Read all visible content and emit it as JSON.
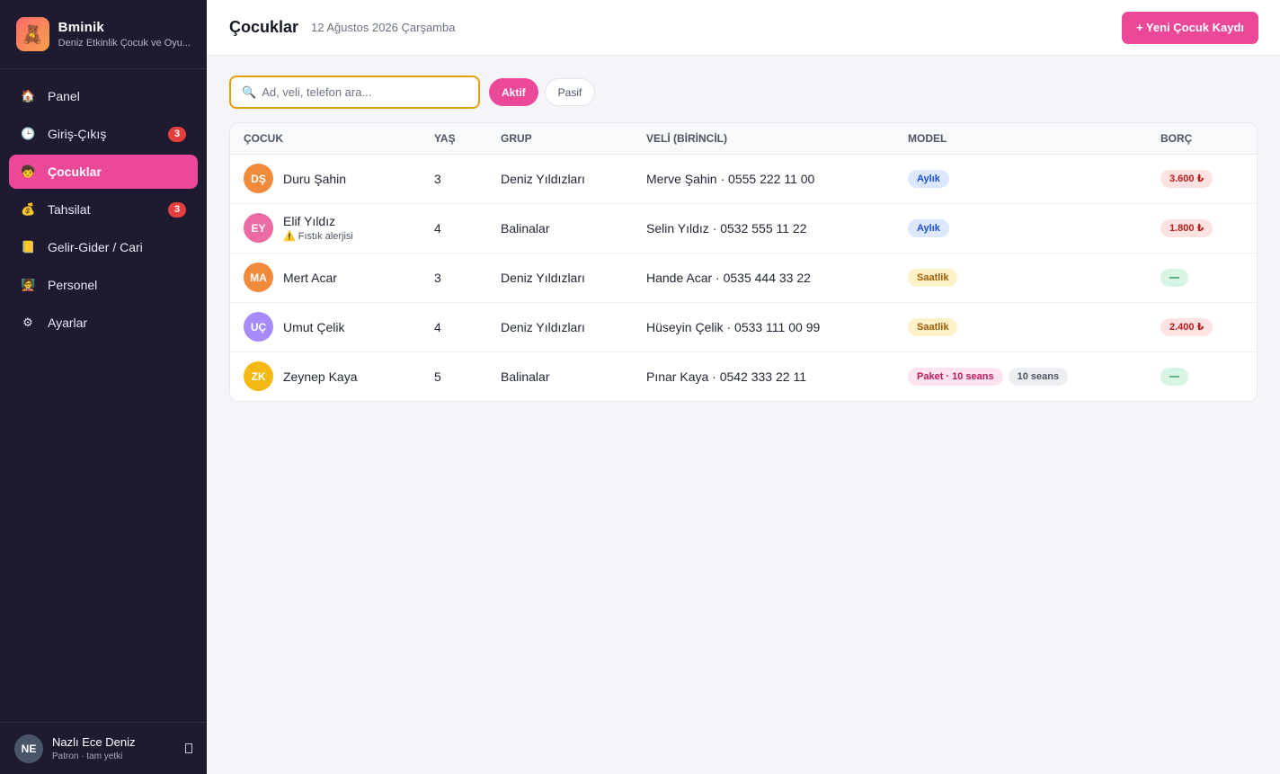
{
  "brand": {
    "icon": "teddy-bear-icon",
    "name": "Bminik",
    "subtitle": "Deniz Etkinlik Çocuk ve Oyu..."
  },
  "nav": [
    {
      "icon": "house-icon",
      "glyph": "🏠",
      "label": "Panel",
      "badge": ""
    },
    {
      "icon": "clock-icon",
      "glyph": "🕒",
      "label": "Giriş-Çıkış",
      "badge": "3"
    },
    {
      "icon": "child-icon",
      "glyph": "🧒",
      "label": "Çocuklar",
      "badge": "",
      "active": true
    },
    {
      "icon": "money-bag-icon",
      "glyph": "💰",
      "label": "Tahsilat",
      "badge": "3"
    },
    {
      "icon": "ledger-icon",
      "glyph": "📒",
      "label": "Gelir-Gider / Cari",
      "badge": ""
    },
    {
      "icon": "staff-icon",
      "glyph": "🧑‍🏫",
      "label": "Personel",
      "badge": ""
    },
    {
      "icon": "gear-icon",
      "glyph": "⚙",
      "label": "Ayarlar",
      "badge": ""
    }
  ],
  "user": {
    "initials": "NE",
    "name": "Nazlı Ece Deniz",
    "role": "Patron · tam yetki"
  },
  "header": {
    "title": "Çocuklar",
    "date": "12 Ağustos 2026 Çarşamba",
    "new_button": "+ Yeni Çocuk Kaydı"
  },
  "filters": {
    "search_placeholder": "Ad, veli, telefon ara...",
    "search_value": "",
    "active_label": "Aktif",
    "passive_label": "Pasif"
  },
  "table": {
    "headers": [
      "ÇOCUK",
      "YAŞ",
      "GRUP",
      "VELİ (BİRİNCİL)",
      "MODEL",
      "BORÇ"
    ],
    "rows": [
      {
        "initials": "DŞ",
        "color": "#f28a3c",
        "name": "Duru Şahin",
        "note": "",
        "age": "3",
        "group": "Deniz Yıldızları",
        "parent": "Merve Şahin · 0555 222 11 00",
        "model": "Aylık",
        "model_type": "aylik",
        "sessions": "",
        "debt": "3.600 ₺",
        "debt_type": "owe"
      },
      {
        "initials": "EY",
        "color": "#ec6ba5",
        "name": "Elif Yıldız",
        "note": "⚠️ Fıstık alerjisi",
        "age": "4",
        "group": "Balinalar",
        "parent": "Selin Yıldız · 0532 555 11 22",
        "model": "Aylık",
        "model_type": "aylik",
        "sessions": "",
        "debt": "1.800 ₺",
        "debt_type": "owe"
      },
      {
        "initials": "MA",
        "color": "#f28a3c",
        "name": "Mert Acar",
        "note": "",
        "age": "3",
        "group": "Deniz Yıldızları",
        "parent": "Hande Acar · 0535 444 33 22",
        "model": "Saatlik",
        "model_type": "saatlik",
        "sessions": "",
        "debt": "—",
        "debt_type": "none"
      },
      {
        "initials": "UÇ",
        "color": "#a78bfa",
        "name": "Umut Çelik",
        "note": "",
        "age": "4",
        "group": "Deniz Yıldızları",
        "parent": "Hüseyin Çelik · 0533 111 00 99",
        "model": "Saatlik",
        "model_type": "saatlik",
        "sessions": "",
        "debt": "2.400 ₺",
        "debt_type": "owe"
      },
      {
        "initials": "ZK",
        "color": "#f5b915",
        "name": "Zeynep Kaya",
        "note": "",
        "age": "5",
        "group": "Balinalar",
        "parent": "Pınar Kaya · 0542 333 22 11",
        "model": "Paket · 10 seans",
        "model_type": "paket",
        "sessions": "10 seans",
        "debt": "—",
        "debt_type": "none"
      }
    ]
  }
}
